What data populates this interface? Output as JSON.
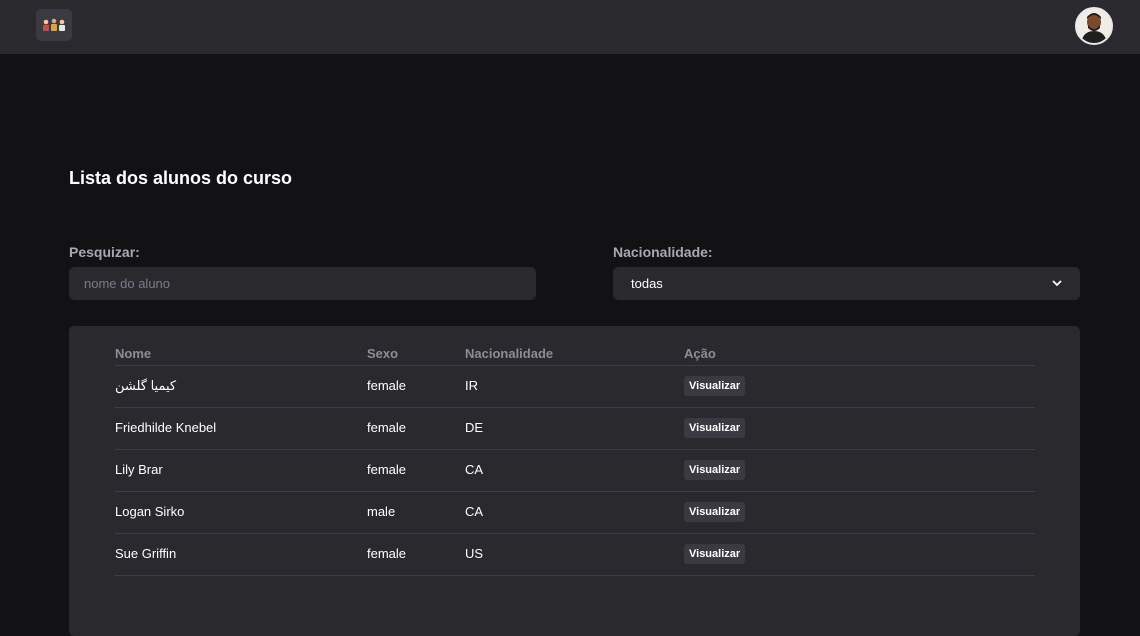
{
  "header": {
    "logo_icon": "students-group-icon",
    "avatar_icon": "user-avatar"
  },
  "main": {
    "title": "Lista dos alunos do curso",
    "search": {
      "label": "Pesquizar:",
      "placeholder": "nome do aluno",
      "value": ""
    },
    "nationality_filter": {
      "label": "Nacionalidade:",
      "selected": "todas",
      "icon": "chevron-down-icon"
    }
  },
  "table": {
    "headers": {
      "nome": "Nome",
      "sexo": "Sexo",
      "nacionalidade": "Nacionalidade",
      "acao": "Ação"
    },
    "rows": [
      {
        "nome": "کیمیا گلشن",
        "sexo": "female",
        "nacionalidade": "IR",
        "acao": "Visualizar"
      },
      {
        "nome": "Friedhilde Knebel",
        "sexo": "female",
        "nacionalidade": "DE",
        "acao": "Visualizar"
      },
      {
        "nome": "Lily Brar",
        "sexo": "female",
        "nacionalidade": "CA",
        "acao": "Visualizar"
      },
      {
        "nome": "Logan Sirko",
        "sexo": "male",
        "nacionalidade": "CA",
        "acao": "Visualizar"
      },
      {
        "nome": "Sue Griffin",
        "sexo": "female",
        "nacionalidade": "US",
        "acao": "Visualizar"
      }
    ]
  }
}
